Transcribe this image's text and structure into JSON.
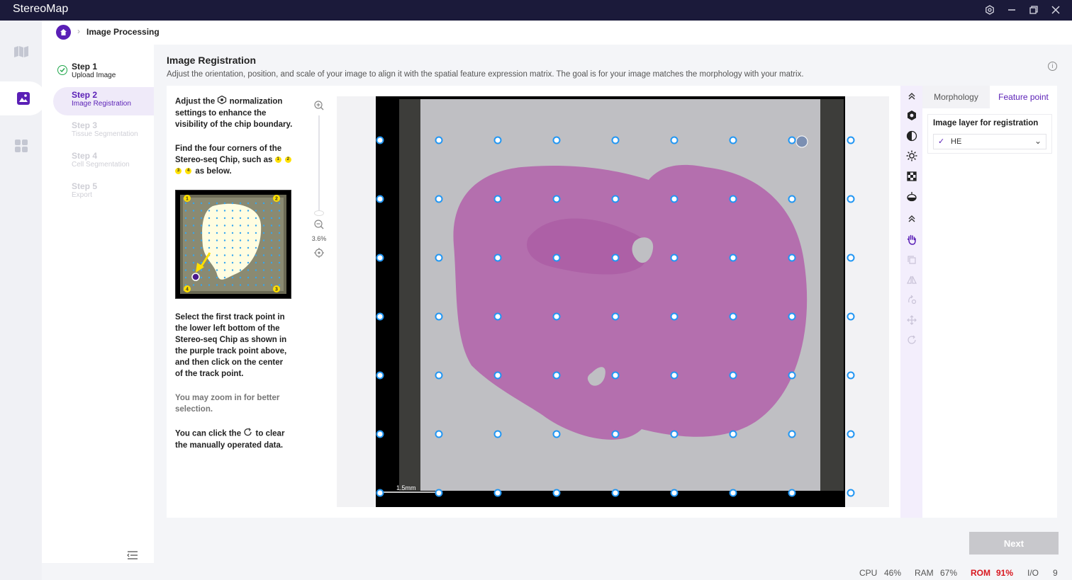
{
  "app": {
    "title": "StereoMap"
  },
  "breadcrumb": {
    "current": "Image Processing"
  },
  "steps": [
    {
      "title": "Step 1",
      "sub": "Upload Image",
      "state": "done"
    },
    {
      "title": "Step 2",
      "sub": "Image Registration",
      "state": "active"
    },
    {
      "title": "Step 3",
      "sub": "Tissue Segmentation",
      "state": "todo"
    },
    {
      "title": "Step 4",
      "sub": "Cell Segmentation",
      "state": "todo"
    },
    {
      "title": "Step 5",
      "sub": "Export",
      "state": "todo"
    }
  ],
  "page": {
    "title": "Image Registration",
    "subtitle": "Adjust the orientation, position, and scale of your image to align it with the spatial feature expression matrix. The goal is for your image matches the morphology with your matrix."
  },
  "instructions": {
    "p1_a": "Adjust the",
    "p1_b": "normalization settings to enhance the visibility of the chip boundary.",
    "p2_a": "Find the four corners of the Stereo-seq Chip, such as",
    "p2_b": "as below.",
    "corner_labels": [
      "1",
      "2",
      "3",
      "4"
    ],
    "p3": "Select the first track point in the lower left bottom of the Stereo-seq Chip as shown in the purple track point above, and then click on the center of the track point.",
    "p4": "You may zoom in for better selection.",
    "p5_a": "You can click the",
    "p5_b": "to clear the manually operated data."
  },
  "viewer": {
    "zoom_label": "3.6%",
    "scale_bar": "1.5mm"
  },
  "right_panel": {
    "tabs": [
      "Morphology",
      "Feature point"
    ],
    "active_tab": "Feature point",
    "layer_title": "Image layer for registration",
    "layer_value": "HE"
  },
  "actions": {
    "next_label": "Next"
  },
  "status": {
    "cpu_label": "CPU",
    "cpu_value": "46%",
    "ram_label": "RAM",
    "ram_value": "67%",
    "rom_label": "ROM",
    "rom_value": "91%",
    "io_label": "I/O",
    "io_value": "9"
  },
  "colors": {
    "accent": "#5a1fb6",
    "titlebar": "#1b1a3a",
    "rom_alert": "#d8171f",
    "track_point": "#2196f3"
  },
  "icons": [
    "settings-icon",
    "minimize-icon",
    "restore-icon",
    "close-icon",
    "home-icon",
    "map-icon",
    "image-icon",
    "grid-icon",
    "zoom-in-icon",
    "zoom-out-icon",
    "locate-icon",
    "normalize-icon",
    "contrast-icon",
    "brightness-icon",
    "checker-icon",
    "drop-icon",
    "hand-icon",
    "reset-icon"
  ]
}
